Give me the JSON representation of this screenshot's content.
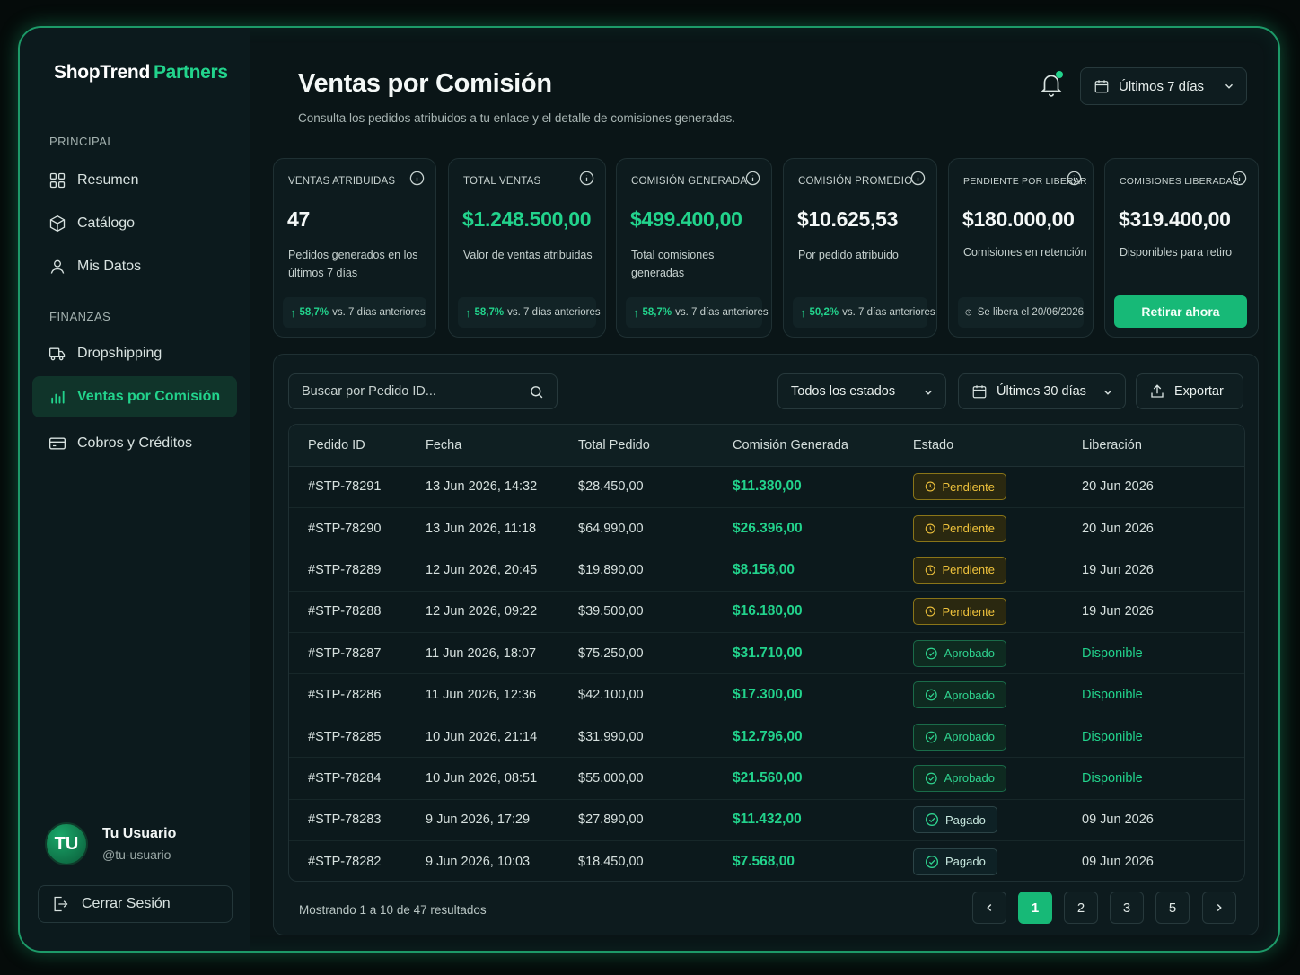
{
  "brand": {
    "part1": "ShopTrend",
    "part2": "Partners"
  },
  "sidebar": {
    "section_principal": "PRINCIPAL",
    "section_finanzas": "FINANZAS",
    "items": [
      {
        "label": "Resumen",
        "icon": "grid-icon"
      },
      {
        "label": "Catálogo",
        "icon": "box-icon"
      },
      {
        "label": "Mis Datos",
        "icon": "user-icon"
      },
      {
        "label": "Dropshipping",
        "icon": "truck-icon"
      },
      {
        "label": "Ventas por Comisión",
        "icon": "bar-chart-icon",
        "active": true
      },
      {
        "label": "Cobros y Créditos",
        "icon": "card-icon"
      }
    ],
    "user": {
      "initials": "TU",
      "name": "Tu Usuario",
      "handle": "@tu-usuario"
    },
    "logout_label": "Cerrar Sesión"
  },
  "header": {
    "title": "Ventas por Comisión",
    "subtitle": "Consulta los pedidos atribuidos a tu enlace y el detalle de comisiones generadas.",
    "range_label": "Últimos 7 días"
  },
  "kpis": [
    {
      "label": "VENTAS ATRIBUIDAS",
      "value": "47",
      "desc": "Pedidos generados en los últimos 7 días",
      "change": "58,7%",
      "change_text": "vs. 7 días anteriores"
    },
    {
      "label": "TOTAL VENTAS",
      "value": "$1.248.500,00",
      "desc": "Valor de ventas atribuidas",
      "change": "58,7%",
      "change_text": "vs. 7 días anteriores"
    },
    {
      "label": "COMISIÓN GENERADA",
      "value": "$499.400,00",
      "desc": "Total comisiones generadas",
      "change": "58,7%",
      "change_text": "vs. 7 días anteriores"
    },
    {
      "label": "COMISIÓN PROMEDIO",
      "value": "$10.625,53",
      "desc": "Por pedido atribuido",
      "change": "50,2%",
      "change_text": "vs. 7 días anteriores"
    },
    {
      "label": "PENDIENTE POR LIBERAR",
      "value": "$180.000,00",
      "desc": "Comisiones en retención",
      "foot": "Se libera el 20/06/2026"
    },
    {
      "label": "COMISIONES LIBERADAS",
      "value": "$319.400,00",
      "desc": "Disponibles para retiro",
      "button": "Retirar ahora"
    }
  ],
  "colors": {
    "accent": "#22d38c",
    "pending": "#f0c33c",
    "background": "#0a1517"
  },
  "filters": {
    "search_placeholder": "Buscar por Pedido ID...",
    "status_select": "Todos los estados",
    "range_select": "Últimos 30 días",
    "export_label": "Exportar"
  },
  "table": {
    "headers": [
      "Pedido ID",
      "Fecha",
      "Total Pedido",
      "Comisión Generada",
      "Estado",
      "Liberación"
    ],
    "rows": [
      {
        "id": "#STP-78291",
        "date": "13 Jun 2026, 14:32",
        "total": "$28.450,00",
        "commission": "$11.380,00",
        "status": "Pendiente",
        "status_type": "pending",
        "release": "20 Jun 2026"
      },
      {
        "id": "#STP-78290",
        "date": "13 Jun 2026, 11:18",
        "total": "$64.990,00",
        "commission": "$26.396,00",
        "status": "Pendiente",
        "status_type": "pending",
        "release": "20 Jun 2026"
      },
      {
        "id": "#STP-78289",
        "date": "12 Jun 2026, 20:45",
        "total": "$19.890,00",
        "commission": "$8.156,00",
        "status": "Pendiente",
        "status_type": "pending",
        "release": "19 Jun 2026"
      },
      {
        "id": "#STP-78288",
        "date": "12 Jun 2026, 09:22",
        "total": "$39.500,00",
        "commission": "$16.180,00",
        "status": "Pendiente",
        "status_type": "pending",
        "release": "19 Jun 2026"
      },
      {
        "id": "#STP-78287",
        "date": "11 Jun 2026, 18:07",
        "total": "$75.250,00",
        "commission": "$31.710,00",
        "status": "Aprobado",
        "status_type": "approved",
        "release": "Disponible"
      },
      {
        "id": "#STP-78286",
        "date": "11 Jun 2026, 12:36",
        "total": "$42.100,00",
        "commission": "$17.300,00",
        "status": "Aprobado",
        "status_type": "approved",
        "release": "Disponible"
      },
      {
        "id": "#STP-78285",
        "date": "10 Jun 2026, 21:14",
        "total": "$31.990,00",
        "commission": "$12.796,00",
        "status": "Aprobado",
        "status_type": "approved",
        "release": "Disponible"
      },
      {
        "id": "#STP-78284",
        "date": "10 Jun 2026, 08:51",
        "total": "$55.000,00",
        "commission": "$21.560,00",
        "status": "Aprobado",
        "status_type": "approved",
        "release": "Disponible"
      },
      {
        "id": "#STP-78283",
        "date": "9 Jun 2026, 17:29",
        "total": "$27.890,00",
        "commission": "$11.432,00",
        "status": "Pagado",
        "status_type": "paid",
        "release": "09 Jun 2026"
      },
      {
        "id": "#STP-78282",
        "date": "9 Jun 2026, 10:03",
        "total": "$18.450,00",
        "commission": "$7.568,00",
        "status": "Pagado",
        "status_type": "paid",
        "release": "09 Jun 2026"
      }
    ]
  },
  "pagination": {
    "summary": "Mostrando 1 a 10 de 47 resultados",
    "pages": [
      "1",
      "2",
      "3",
      "5"
    ],
    "current": "1"
  }
}
